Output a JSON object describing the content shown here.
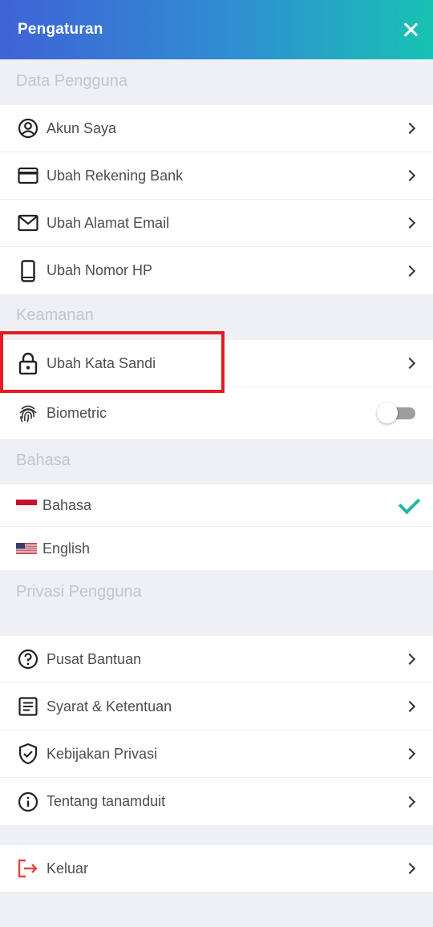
{
  "header": {
    "title": "Pengaturan",
    "close_icon": "close-icon"
  },
  "sections": {
    "data_pengguna": "Data Pengguna",
    "keamanan": "Keamanan",
    "bahasa": "Bahasa",
    "privasi": "Privasi Pengguna"
  },
  "data_pengguna_items": [
    {
      "label": "Akun Saya",
      "icon": "account-circle-icon"
    },
    {
      "label": "Ubah Rekening Bank",
      "icon": "credit-card-icon"
    },
    {
      "label": "Ubah Alamat Email",
      "icon": "mail-icon"
    },
    {
      "label": "Ubah Nomor HP",
      "icon": "smartphone-icon"
    }
  ],
  "keamanan_items": [
    {
      "label": "Ubah Kata Sandi",
      "icon": "lock-icon"
    },
    {
      "label": "Biometric",
      "icon": "fingerprint-icon",
      "toggle_on": false
    }
  ],
  "bahasa_items": [
    {
      "label": "Bahasa",
      "flag": "indonesia-flag",
      "selected": true
    },
    {
      "label": "English",
      "flag": "us-flag",
      "selected": false
    }
  ],
  "privasi_items": [
    {
      "label": "Pusat Bantuan",
      "icon": "help-circle-icon"
    },
    {
      "label": "Syarat & Ketentuan",
      "icon": "document-icon"
    },
    {
      "label": "Kebijakan Privasi",
      "icon": "shield-check-icon"
    },
    {
      "label": "Tentang tanamduit",
      "icon": "info-icon"
    }
  ],
  "logout": {
    "label": "Keluar",
    "icon": "logout-icon"
  },
  "colors": {
    "accent": "#26b5a5",
    "logout": "#e4473a",
    "highlight": "#e41b23"
  }
}
